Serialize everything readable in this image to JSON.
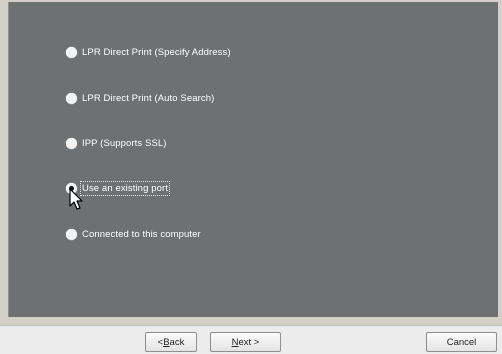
{
  "options": [
    {
      "label": "LPR Direct Print (Specify Address)",
      "checked": false
    },
    {
      "label": "LPR Direct Print (Auto Search)",
      "checked": false
    },
    {
      "label": "IPP (Supports SSL)",
      "checked": false
    },
    {
      "label": "Use an existing port",
      "checked": true
    },
    {
      "label": "Connected to this computer",
      "checked": false
    }
  ],
  "buttons": {
    "back_prefix": "< ",
    "back_accel": "B",
    "back_rest": "ack",
    "next_accel": "N",
    "next_rest": "ext >",
    "cancel": "Cancel"
  },
  "cursor": {
    "icon": "arrow-pointer-icon"
  }
}
